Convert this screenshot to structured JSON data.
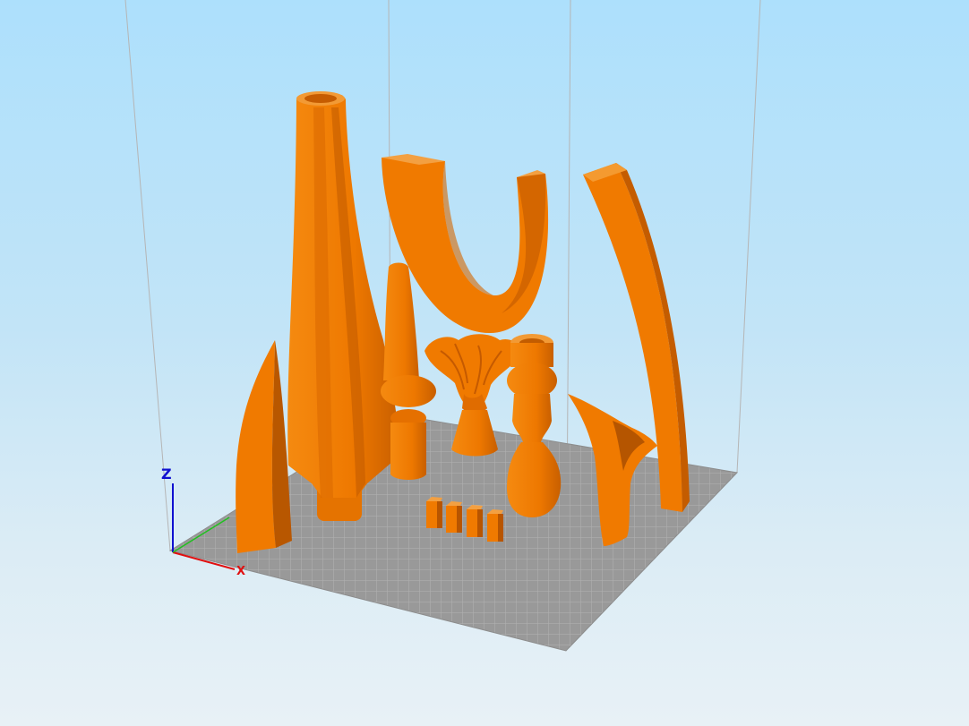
{
  "scene": {
    "model_color": "#f07c00",
    "bed_color": "#9a9a9a",
    "bed_grid_color": "#b6b6b6",
    "frame_line_color": "#b9b9b9",
    "background_top": "#ade0fc",
    "background_bottom": "#e8f1f6"
  },
  "axes": {
    "z_label": "Z",
    "x_label": "X",
    "x_color": "#e01010",
    "y_color": "#20c020",
    "z_color": "#1010d0"
  },
  "objects": [
    {
      "name": "tall-fluted-vase",
      "icon": "vase-model-icon"
    },
    {
      "name": "pointed-leaf-spike",
      "icon": "spike-model-icon"
    },
    {
      "name": "turned-finial",
      "icon": "finial-model-icon"
    },
    {
      "name": "u-shaped-arch",
      "icon": "arch-model-icon"
    },
    {
      "name": "acanthus-capital",
      "icon": "capital-model-icon"
    },
    {
      "name": "baluster-column",
      "icon": "baluster-model-icon"
    },
    {
      "name": "curved-beam",
      "icon": "beam-model-icon"
    },
    {
      "name": "twisted-horn",
      "icon": "horn-model-icon"
    },
    {
      "name": "small-pegs",
      "icon": "peg-model-icon"
    }
  ]
}
